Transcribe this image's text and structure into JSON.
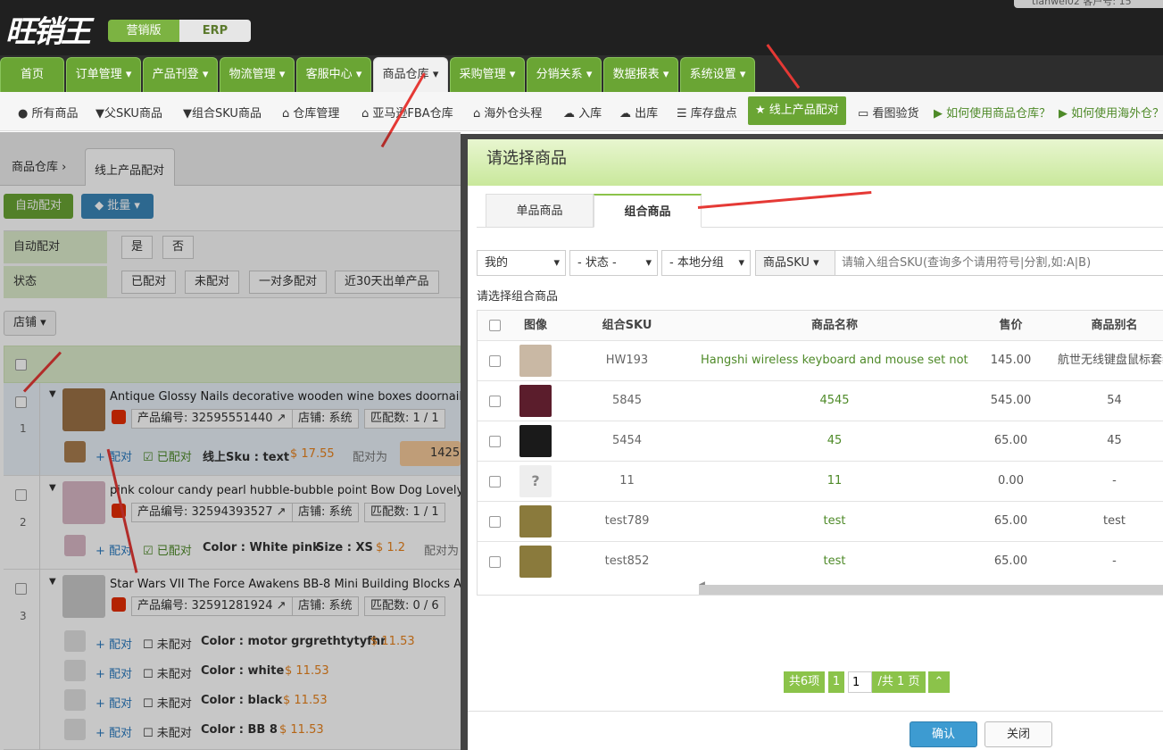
{
  "brand": {
    "logo": "旺销王",
    "version_active": "营销版",
    "version_other": "ERP",
    "user_partial": "tianwei02 客户号: 15"
  },
  "nav": {
    "items": [
      "首页",
      "订单管理",
      "产品刊登",
      "物流管理",
      "客服中心",
      "商品仓库",
      "采购管理",
      "分销关系",
      "数据报表",
      "系统设置"
    ],
    "active": "商品仓库"
  },
  "subnav": [
    "所有商品",
    "父SKU商品",
    "组合SKU商品",
    "仓库管理",
    "亚马逊FBA仓库",
    "海外仓头程",
    "入库",
    "出库",
    "库存盘点",
    "线上产品配对",
    "看图验货",
    "如何使用商品仓库？",
    "如何使用海外仓？"
  ],
  "subnav_active": "线上产品配对",
  "left": {
    "tabs": [
      "商品仓库",
      "线上产品配对"
    ],
    "btn_auto": "自动配对",
    "btn_batch": "批量",
    "filter1_label": "自动配对",
    "filter1_opts": [
      "是",
      "否"
    ],
    "filter2_label": "状态",
    "filter2_opts": [
      "已配对",
      "未配对",
      "一对多配对",
      "近30天出单产品"
    ],
    "shop_btn": "店铺",
    "rows": [
      {
        "num": "1",
        "title": "Antique Glossy Nails decorative wooden wine boxes doornail so",
        "pid": "产品编号: 32595551440",
        "shop": "店铺: 系统",
        "match": "匹配数: 1 / 1",
        "variant": {
          "action": "配对",
          "status": "已配对",
          "attr": "线上Sku : text",
          "price": "$ 17.55",
          "matched_to": "配对为",
          "sku": "1425"
        }
      },
      {
        "num": "2",
        "title": "pink colour candy pearl hubble-bubble point Bow Dog Lovely p",
        "pid": "产品编号: 32594393527",
        "shop": "店铺: 系统",
        "match": "匹配数: 1 / 1",
        "variant": {
          "action": "配对",
          "status": "已配对",
          "attr": "Color : White pink",
          "size": "Size : XS",
          "price": "$ 1.2",
          "matched_to": "配对为"
        }
      },
      {
        "num": "3",
        "title": "Star Wars VII The Force Awakens BB-8 Mini Building Blocks ABS",
        "pid": "产品编号: 32591281924",
        "shop": "店铺: 系统",
        "match": "匹配数: 0 / 6",
        "variants": [
          {
            "action": "配对",
            "status": "未配对",
            "attr": "Color : motor grgrethtytyfhr",
            "price": "$ 11.53"
          },
          {
            "action": "配对",
            "status": "未配对",
            "attr": "Color : white",
            "price": "$ 11.53"
          },
          {
            "action": "配对",
            "status": "未配对",
            "attr": "Color : black",
            "price": "$ 11.53"
          },
          {
            "action": "配对",
            "status": "未配对",
            "attr": "Color : BB 8",
            "price": "$ 11.53"
          }
        ]
      }
    ]
  },
  "dialog": {
    "title": "请选择商品",
    "tabs": [
      "单品商品",
      "组合商品"
    ],
    "active_tab": "组合商品",
    "filters": [
      "我的",
      "- 状态 -",
      "- 本地分组",
      "商品SKU"
    ],
    "search_placeholder": "请输入组合SKU(查询多个请用符号|分割,如:A|B)",
    "hint": "请选择组合商品",
    "columns": [
      "图像",
      "组合SKU",
      "商品名称",
      "售价",
      "商品别名"
    ],
    "rows": [
      {
        "sku": "HW193",
        "name": "Hangshi wireless keyboard and mouse set not...",
        "price": "145.00",
        "alias": "航世无线键盘鼠标套装"
      },
      {
        "sku": "5845",
        "name": "4545",
        "price": "545.00",
        "alias": "54"
      },
      {
        "sku": "5454",
        "name": "45",
        "price": "65.00",
        "alias": "45"
      },
      {
        "sku": "11",
        "name": "11",
        "price": "0.00",
        "alias": "-"
      },
      {
        "sku": "test789",
        "name": "test",
        "price": "65.00",
        "alias": "test"
      },
      {
        "sku": "test852",
        "name": "test",
        "price": "65.00",
        "alias": "-"
      }
    ],
    "pager": {
      "total": "共6项",
      "current": "1",
      "page_input": "1",
      "pages": "/共 1 页"
    },
    "btn_ok": "确认",
    "btn_close": "关闭"
  }
}
